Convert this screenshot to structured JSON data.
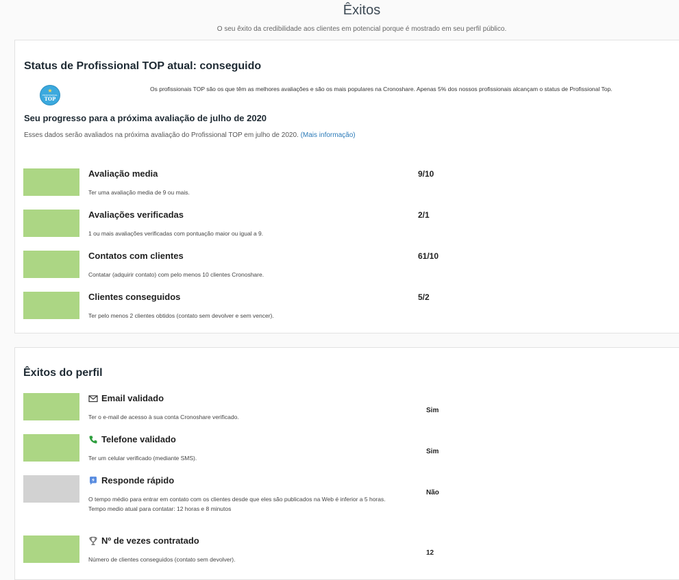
{
  "header": {
    "title": "Êxitos",
    "subtitle": "O seu êxito da credibilidade aos clientes em potencial porque é mostrado em seu perfil público."
  },
  "status": {
    "heading": "Status de Profissional TOP atual: conseguido",
    "badge_small": "PROFISSIONAL",
    "badge_big": "TOP",
    "top_description": "Os profissionais TOP são os que têm as melhores avaliações e são os mais populares na Cronoshare. Apenas 5% dos nossos profissionais alcançam o status de Profissional Top.",
    "progress_heading": "Seu progresso para a próxima avaliação de julho de 2020",
    "progress_description": "Esses dados serão avaliados na próxima avaliação do Profissional TOP em julho de 2020.",
    "more_info_link": "(Mais informação)",
    "criteria": [
      {
        "title": "Avaliação media",
        "description": "Ter uma avaliação media de 9 ou mais.",
        "value": "9/10",
        "met": true
      },
      {
        "title": "Avaliações verificadas",
        "description": "1 ou mais avaliações verificadas com pontuação maior ou igual a 9.",
        "value": "2/1",
        "met": true
      },
      {
        "title": "Contatos com clientes",
        "description": "Contatar (adquirir contato) com pelo menos 10 clientes Cronoshare.",
        "value": "61/10",
        "met": true
      },
      {
        "title": "Clientes conseguidos",
        "description": "Ter pelo menos 2 clientes obtidos (contato sem devolver e sem vencer).",
        "value": "5/2",
        "met": true
      }
    ]
  },
  "profile": {
    "heading": "Êxitos do perfil",
    "items": [
      {
        "icon": "envelope-icon",
        "title": "Email validado",
        "description": "Ter o e-mail de acesso à sua conta Cronoshare verificado.",
        "description_2": "",
        "value": "Sim",
        "met": true
      },
      {
        "icon": "phone-icon",
        "title": "Telefone validado",
        "description": "Ter um celular verificado (mediante SMS).",
        "description_2": "",
        "value": "Sim",
        "met": true
      },
      {
        "icon": "lightning-icon",
        "title": "Responde rápido",
        "description": "O tempo médio para entrar em contato com os clientes desde que eles são publicados na Web é inferior a 5 horas.",
        "description_2": "Tempo medio atual para contatar: 12 horas e 8 minutos",
        "value": "Não",
        "met": false
      },
      {
        "icon": "trophy-icon",
        "title": "Nº de vezes contratado",
        "description": "Número de clientes conseguidos (contato sem devolver).",
        "description_2": "",
        "value": "12",
        "met": true
      }
    ]
  },
  "colors": {
    "met": "#acd684",
    "unmet": "#d2d2d2",
    "link": "#2a7ab8",
    "phone": "#2e9e3e",
    "lightning": "#5a8de0"
  }
}
